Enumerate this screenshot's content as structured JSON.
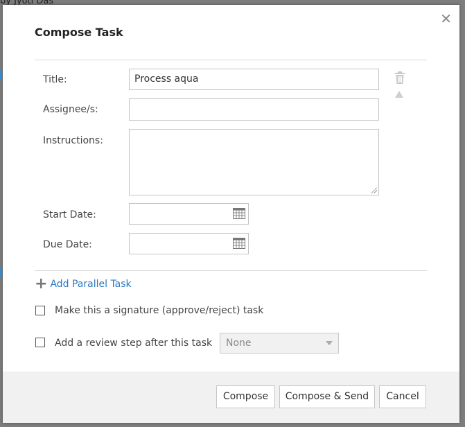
{
  "background": {
    "byline": "by Jyoti Das"
  },
  "dialog": {
    "title": "Compose Task",
    "close_icon": "close-icon",
    "fields": {
      "title_label": "Title:",
      "title_value": "Process aqua",
      "assignee_label": "Assignee/s:",
      "assignee_value": "",
      "instructions_label": "Instructions:",
      "instructions_value": "",
      "start_date_label": "Start Date:",
      "start_date_value": "",
      "due_date_label": "Due Date:",
      "due_date_value": ""
    },
    "add_parallel_task": "Add Parallel Task",
    "signature_checkbox_label": "Make this a signature (approve/reject) task",
    "signature_checked": false,
    "review_checkbox_label": "Add a review step after this task",
    "review_checked": false,
    "review_select_value": "None",
    "buttons": {
      "compose": "Compose",
      "compose_send": "Compose & Send",
      "cancel": "Cancel"
    },
    "colors": {
      "link": "#2b78c2",
      "footer_bg": "#f1f1f1",
      "border": "#c3c3c3"
    }
  }
}
